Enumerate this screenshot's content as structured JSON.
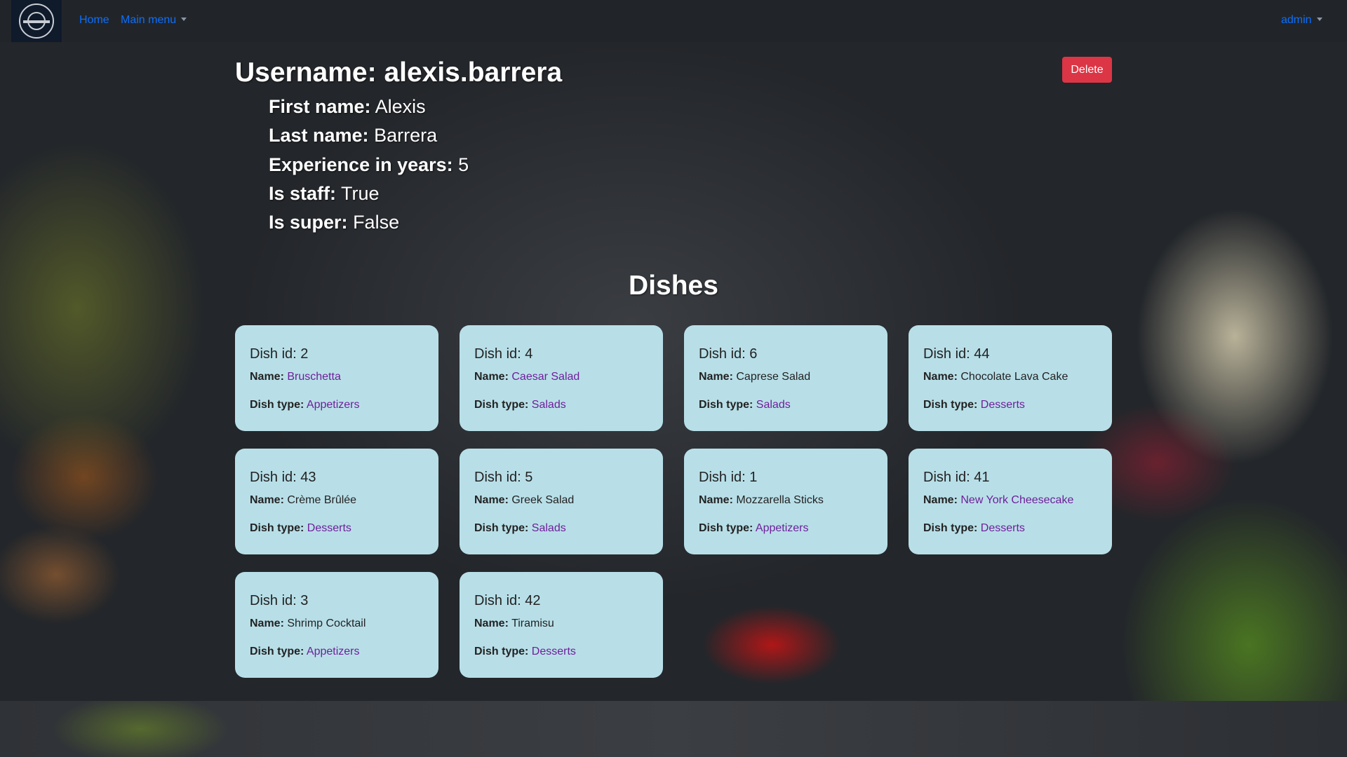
{
  "navbar": {
    "home": "Home",
    "main_menu": "Main menu",
    "user": "admin"
  },
  "profile": {
    "username_label": "Username:",
    "username": "alexis.barrera",
    "first_name_label": "First name:",
    "first_name": "Alexis",
    "last_name_label": "Last name:",
    "last_name": "Barrera",
    "experience_label": "Experience in years:",
    "experience": "5",
    "is_staff_label": "Is staff:",
    "is_staff": "True",
    "is_super_label": "Is super:",
    "is_super": "False",
    "delete_label": "Delete"
  },
  "dishes": {
    "title": "Dishes",
    "name_label": "Name:",
    "type_label": "Dish type:",
    "id_prefix": "Dish id:",
    "items": [
      {
        "id": "2",
        "name": "Bruschetta",
        "name_link": true,
        "type": "Appetizers"
      },
      {
        "id": "4",
        "name": "Caesar Salad",
        "name_link": true,
        "type": "Salads"
      },
      {
        "id": "6",
        "name": "Caprese Salad",
        "name_link": false,
        "type": "Salads"
      },
      {
        "id": "44",
        "name": "Chocolate Lava Cake",
        "name_link": false,
        "type": "Desserts"
      },
      {
        "id": "43",
        "name": "Crème Brûlée",
        "name_link": false,
        "type": "Desserts"
      },
      {
        "id": "5",
        "name": "Greek Salad",
        "name_link": false,
        "type": "Salads"
      },
      {
        "id": "1",
        "name": "Mozzarella Sticks",
        "name_link": false,
        "type": "Appetizers"
      },
      {
        "id": "41",
        "name": "New York Cheesecake",
        "name_link": true,
        "type": "Desserts"
      },
      {
        "id": "3",
        "name": "Shrimp Cocktail",
        "name_link": false,
        "type": "Appetizers"
      },
      {
        "id": "42",
        "name": "Tiramisu",
        "name_link": false,
        "type": "Desserts"
      }
    ]
  }
}
